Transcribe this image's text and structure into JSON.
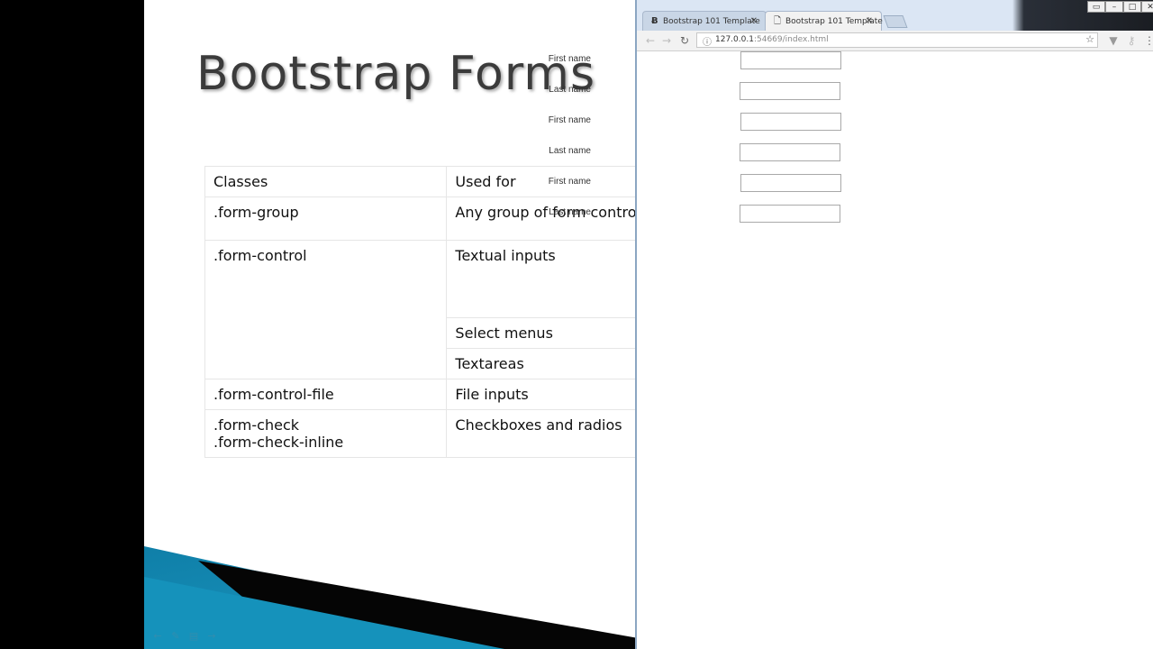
{
  "slide": {
    "title": "Bootstrap Forms",
    "table": {
      "headers": [
        "Classes",
        "Used for"
      ],
      "rows": [
        {
          "cls": ".form-group",
          "used": "Any group of form contro"
        },
        {
          "cls": ".form-control",
          "used": "Textual inputs"
        },
        {
          "cls": "",
          "used": "Select menus"
        },
        {
          "cls": "",
          "used": "Textareas"
        },
        {
          "cls": ".form-control-file",
          "used": "File inputs"
        },
        {
          "cls": ".form-check",
          "cls2": ".form-check-inline",
          "used": "Checkboxes and radios"
        }
      ]
    }
  },
  "browser": {
    "tabs": [
      {
        "title": "Bootstrap 101 Template",
        "active": false
      },
      {
        "title": "Bootstrap 101 Template",
        "active": true
      }
    ],
    "url_host": "127.0.0.1",
    "url_rest": ":54669/index.html",
    "form": {
      "rows": [
        {
          "label": "First name",
          "value": ""
        },
        {
          "label": "Last name",
          "value": ""
        },
        {
          "label": "First name",
          "value": ""
        },
        {
          "label": "Last name",
          "value": ""
        },
        {
          "label": "First name",
          "value": ""
        },
        {
          "label": "Last name",
          "value": ""
        }
      ]
    }
  },
  "colors": {
    "slide_accent": "#1b8db4",
    "titlebar": "#dbe6f4"
  }
}
